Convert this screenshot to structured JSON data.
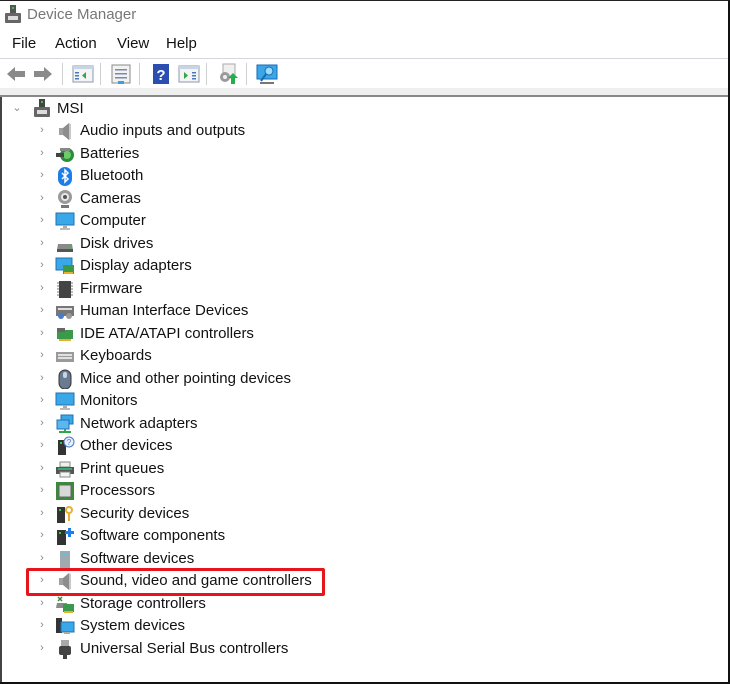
{
  "window": {
    "title": "Device Manager"
  },
  "menu": [
    "File",
    "Action",
    "View",
    "Help"
  ],
  "toolbar": [
    {
      "icon": "back-arrow-icon"
    },
    {
      "icon": "forward-arrow-icon"
    },
    {
      "icon": "show-hide-console-tree-icon"
    },
    {
      "icon": "properties-icon"
    },
    {
      "icon": "help-icon"
    },
    {
      "icon": "show-action-pane-icon"
    },
    {
      "icon": "update-driver-icon"
    },
    {
      "icon": "scan-hardware-changes-icon"
    }
  ],
  "tree": {
    "root": {
      "label": "MSI",
      "expanded": true
    },
    "items": [
      {
        "label": "Audio inputs and outputs",
        "icon": "speaker-icon"
      },
      {
        "label": "Batteries",
        "icon": "battery-icon"
      },
      {
        "label": "Bluetooth",
        "icon": "bluetooth-icon"
      },
      {
        "label": "Cameras",
        "icon": "camera-icon"
      },
      {
        "label": "Computer",
        "icon": "computer-icon"
      },
      {
        "label": "Disk drives",
        "icon": "disk-drive-icon"
      },
      {
        "label": "Display adapters",
        "icon": "display-adapter-icon"
      },
      {
        "label": "Firmware",
        "icon": "firmware-chip-icon"
      },
      {
        "label": "Human Interface Devices",
        "icon": "hid-icon"
      },
      {
        "label": "IDE ATA/ATAPI controllers",
        "icon": "ide-controller-icon"
      },
      {
        "label": "Keyboards",
        "icon": "keyboard-icon"
      },
      {
        "label": "Mice and other pointing devices",
        "icon": "mouse-icon"
      },
      {
        "label": "Monitors",
        "icon": "monitor-icon"
      },
      {
        "label": "Network adapters",
        "icon": "network-adapter-icon"
      },
      {
        "label": "Other devices",
        "icon": "other-devices-icon"
      },
      {
        "label": "Print queues",
        "icon": "printer-icon"
      },
      {
        "label": "Processors",
        "icon": "processor-icon"
      },
      {
        "label": "Security devices",
        "icon": "security-key-icon"
      },
      {
        "label": "Software components",
        "icon": "software-component-icon"
      },
      {
        "label": "Software devices",
        "icon": "software-device-icon"
      },
      {
        "label": "Sound, video and game controllers",
        "icon": "speaker-icon",
        "highlighted": true
      },
      {
        "label": "Storage controllers",
        "icon": "storage-controller-icon"
      },
      {
        "label": "System devices",
        "icon": "system-devices-icon"
      },
      {
        "label": "Universal Serial Bus controllers",
        "icon": "usb-icon"
      }
    ]
  },
  "colors": {
    "highlight": "#e8141b"
  }
}
